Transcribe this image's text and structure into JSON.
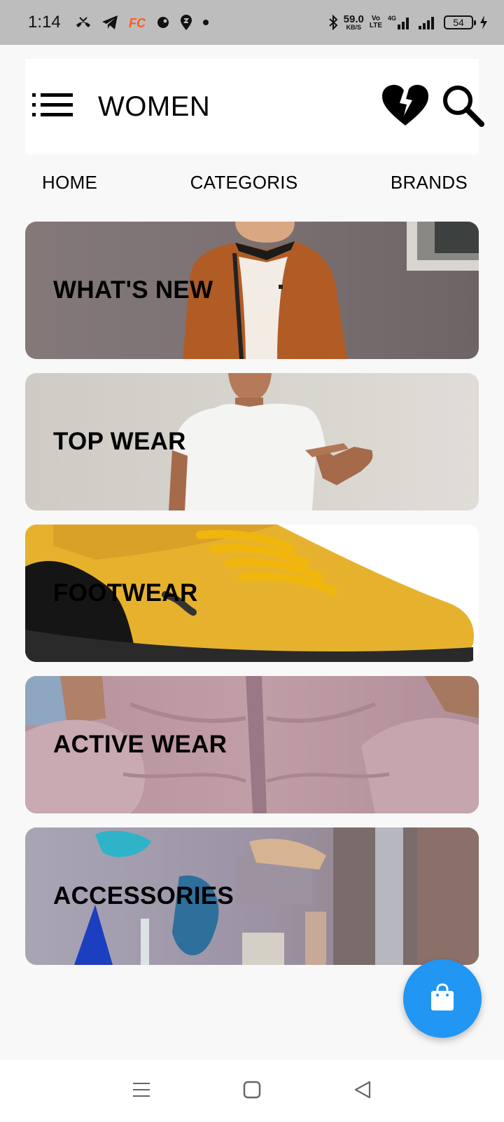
{
  "status_bar": {
    "time": "1:14",
    "net_speed_value": "59.0",
    "net_speed_unit": "KB/S",
    "volte_line1": "Vo",
    "volte_line2": "LTE",
    "network_type": "4G",
    "battery": "54",
    "icons": [
      "missed-call-icon",
      "telegram-icon",
      "fc-app-icon",
      "app-icon",
      "swiggy-icon",
      "dot-icon",
      "bluetooth-icon",
      "signal-icon",
      "charging-icon"
    ]
  },
  "header": {
    "title": "WOMEN",
    "icons": [
      "menu-icon",
      "broken-heart-icon",
      "search-icon"
    ]
  },
  "nav": {
    "home": "HOME",
    "categories": "CATEGORIS",
    "brands": "BRANDS"
  },
  "categories": [
    {
      "label": "WHAT'S NEW"
    },
    {
      "label": "TOP WEAR"
    },
    {
      "label": "FOOTWEAR"
    },
    {
      "label": "ACTIVE WEAR"
    },
    {
      "label": "ACCESSORIES"
    }
  ],
  "fab": {
    "icon": "shopping-bag-icon",
    "color": "#2196f3"
  },
  "system_nav": {
    "icons": [
      "recents-icon",
      "home-square-icon",
      "back-triangle-icon"
    ]
  }
}
